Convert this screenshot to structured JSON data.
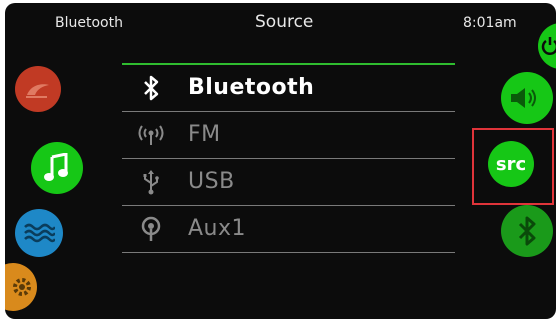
{
  "status_bar": {
    "left": "Bluetooth",
    "center": "Source",
    "right": "8:01am"
  },
  "left_nav": [
    {
      "icon": "jets-icon",
      "color": "#c13a24"
    },
    {
      "icon": "music-note-icon",
      "color": "#16c716"
    },
    {
      "icon": "water-waves-icon",
      "color": "#1e88c7"
    },
    {
      "icon": "gear-icon",
      "color": "#d98a1c"
    }
  ],
  "sources": [
    {
      "label": "Bluetooth",
      "icon": "bluetooth-icon",
      "selected": true
    },
    {
      "label": "FM",
      "icon": "fm-antenna-icon",
      "selected": false
    },
    {
      "label": "USB",
      "icon": "usb-icon",
      "selected": false
    },
    {
      "label": "Aux1",
      "icon": "aux-icon",
      "selected": false
    }
  ],
  "right_controls": {
    "power_color": "#16c716",
    "volume_color": "#16c716",
    "src_label": "src",
    "bluetooth_color": "#1a9a1a",
    "highlight_color": "#e0343a"
  }
}
